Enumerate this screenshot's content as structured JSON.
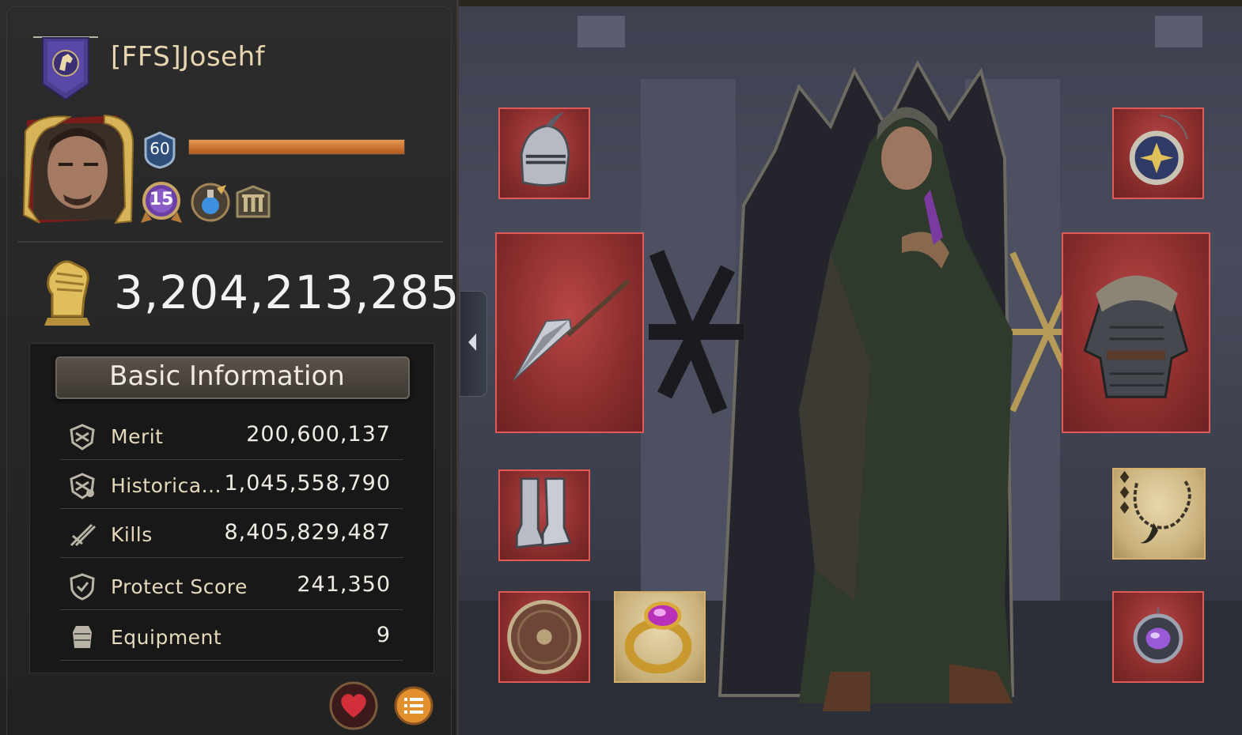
{
  "player": {
    "name": "[FFS]Josehf",
    "level": "60",
    "rank": "15",
    "xp_progress": 1.0
  },
  "power": {
    "value": "3,204,213,285"
  },
  "basic_info": {
    "title": "Basic Information",
    "rows": [
      {
        "label": "Merit",
        "value": "200,600,137",
        "icon": "merit-icon"
      },
      {
        "label": "Historica...",
        "value": "1,045,558,790",
        "icon": "historical-merit-icon"
      },
      {
        "label": "Kills",
        "value": "8,405,829,487",
        "icon": "kills-icon"
      },
      {
        "label": "Protect Score",
        "value": "241,350",
        "icon": "shield-icon"
      },
      {
        "label": "Equipment",
        "value": "9",
        "icon": "armor-icon"
      }
    ]
  },
  "actions": {
    "like": "heart-icon",
    "menu": "list-icon"
  },
  "colors": {
    "slot_red": "#8a2d2d",
    "slot_red_border": "#e05a5a",
    "slot_gold": "#c8b07a",
    "xp_orange": "#d07a36",
    "name_gold": "#e8d6b0"
  },
  "equipment_slots": [
    {
      "slot": "helmet",
      "icon": "helmet-icon",
      "rarity": "red"
    },
    {
      "slot": "weapon",
      "icon": "spear-icon",
      "rarity": "red"
    },
    {
      "slot": "boots",
      "icon": "boots-icon",
      "rarity": "red"
    },
    {
      "slot": "shield",
      "icon": "round-shield-icon",
      "rarity": "red"
    },
    {
      "slot": "ring",
      "icon": "ring-icon",
      "rarity": "gold"
    },
    {
      "slot": "amulet",
      "icon": "amulet-icon",
      "rarity": "red"
    },
    {
      "slot": "armor",
      "icon": "chainmail-icon",
      "rarity": "red"
    },
    {
      "slot": "necklace",
      "icon": "necklace-icon",
      "rarity": "gold"
    },
    {
      "slot": "charm",
      "icon": "gem-charm-icon",
      "rarity": "red"
    }
  ]
}
